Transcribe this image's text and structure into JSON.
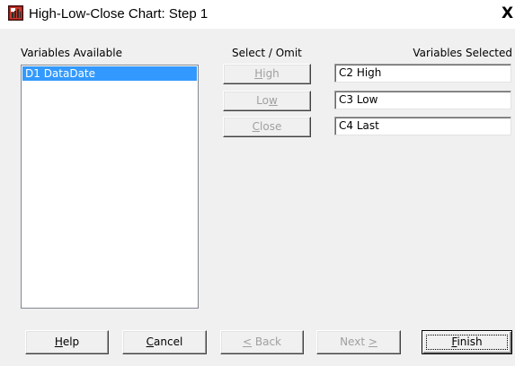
{
  "window": {
    "title": "High-Low-Close Chart: Step 1",
    "close_glyph": "X"
  },
  "labels": {
    "variables_available": "Variables Available",
    "select_omit": "Select / Omit",
    "variables_selected": "Variables Selected"
  },
  "available_list": {
    "items": [
      {
        "label": "D1 DataDate",
        "selected": true
      }
    ]
  },
  "select_buttons": {
    "high": {
      "underline_char": "H",
      "rest": "igh",
      "enabled": false
    },
    "low": {
      "before": "Lo",
      "underline_char": "w",
      "enabled": false
    },
    "close": {
      "underline_char": "C",
      "rest": "lose",
      "enabled": false
    }
  },
  "selected_fields": {
    "high": "C2 High",
    "low": "C3 Low",
    "close": "C4 Last"
  },
  "footer": {
    "help": {
      "underline_char": "H",
      "rest": "elp"
    },
    "cancel": {
      "underline_char": "C",
      "rest": "ancel"
    },
    "back": {
      "underline_char": "<",
      "rest": " Back",
      "enabled": false
    },
    "next": {
      "before": "Next ",
      "underline_char": ">",
      "enabled": false
    },
    "finish": {
      "underline_char": "F",
      "rest": "inish",
      "default": true
    }
  },
  "colors": {
    "selection": "#3399ff",
    "dialog_bg": "#f0f0f0",
    "disabled_text": "#a0a0a0"
  }
}
